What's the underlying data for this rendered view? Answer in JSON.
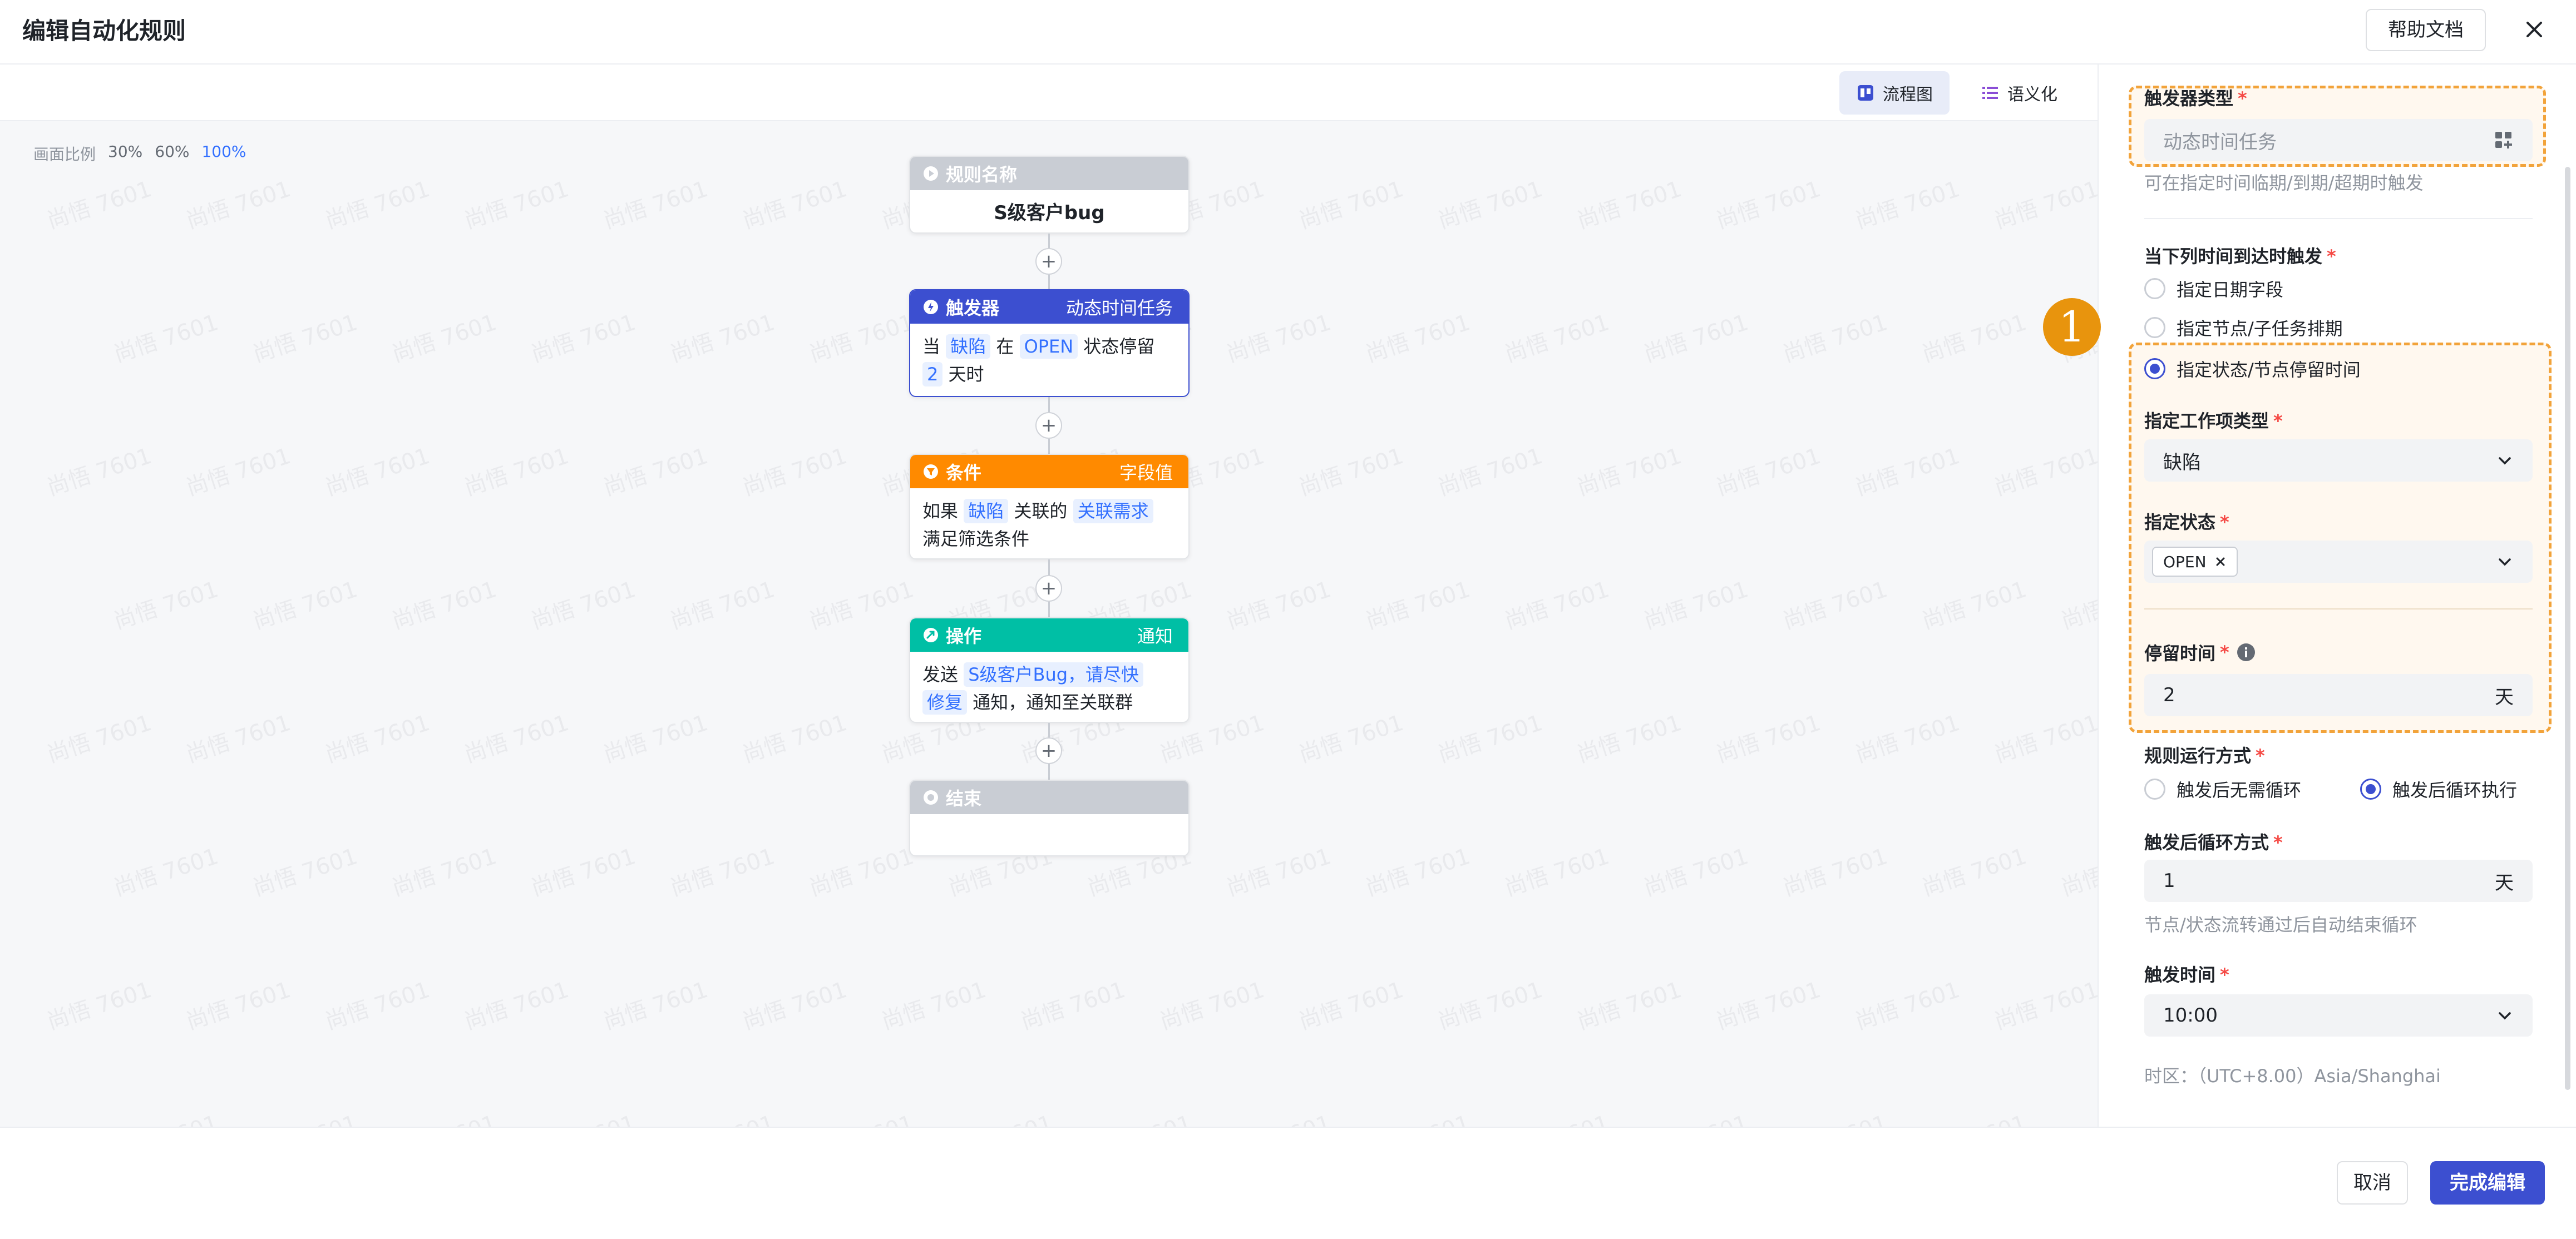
{
  "header": {
    "title": "编辑自动化规则",
    "help_label": "帮助文档"
  },
  "canvas": {
    "view_tabs": [
      {
        "label": "流程图",
        "active": true
      },
      {
        "label": "语义化",
        "active": false
      }
    ],
    "zoom": {
      "label": "画面比例",
      "options": [
        "30%",
        "60%",
        "100%"
      ],
      "selected": "100%"
    },
    "watermark": "尚悟 7601"
  },
  "flow": {
    "rule_name": {
      "header": "规则名称",
      "value": "S级客户bug"
    },
    "trigger": {
      "header": "触发器",
      "type": "动态时间任务",
      "text": {
        "when": "当",
        "item": "缺陷",
        "in": "在",
        "state": "OPEN",
        "stay": "状态停留",
        "days": "2",
        "unit": "天时"
      }
    },
    "condition": {
      "header": "条件",
      "type": "字段值",
      "text": {
        "if": "如果",
        "item": "缺陷",
        "related": "关联的",
        "field": "关联需求",
        "meet": "满足筛选条件"
      }
    },
    "action": {
      "header": "操作",
      "type": "通知",
      "text": {
        "send": "发送",
        "msg_line1": "S级客户Bug，请尽快",
        "msg_line2": "修复",
        "rest": "通知，通知至关联群"
      }
    },
    "end": {
      "header": "结束"
    }
  },
  "panel": {
    "trigger_type": {
      "label": "触发器类型",
      "value": "动态时间任务",
      "hint": "可在指定时间临期/到期/超期时触发"
    },
    "time_reach": {
      "label": "当下列时间到达时触发",
      "options": [
        "指定日期字段",
        "指定节点/子任务排期",
        "指定状态/节点停留时间"
      ],
      "selected": 2
    },
    "work_item_type": {
      "label": "指定工作项类型",
      "value": "缺陷"
    },
    "state": {
      "label": "指定状态",
      "chips": [
        "OPEN"
      ]
    },
    "stay_time": {
      "label": "停留时间",
      "value": "2",
      "unit": "天"
    },
    "run_mode": {
      "label": "规则运行方式",
      "options": [
        "触发后无需循环",
        "触发后循环执行"
      ],
      "selected": 1
    },
    "loop_mode": {
      "label": "触发后循环方式",
      "value": "1",
      "unit": "天",
      "hint": "节点/状态流转通过后自动结束循环"
    },
    "trigger_time": {
      "label": "触发时间",
      "value": "10:00",
      "timezone": "时区：（UTC+8.00）Asia/Shanghai"
    },
    "annotation": "1"
  },
  "footer": {
    "cancel_label": "取消",
    "done_label": "完成编辑"
  },
  "colors": {
    "primary": "#3c4fd0",
    "trigger": "#3c4fd0",
    "condition": "#ff8a00",
    "action": "#00bfa5",
    "highlight": "#f2a33a"
  }
}
